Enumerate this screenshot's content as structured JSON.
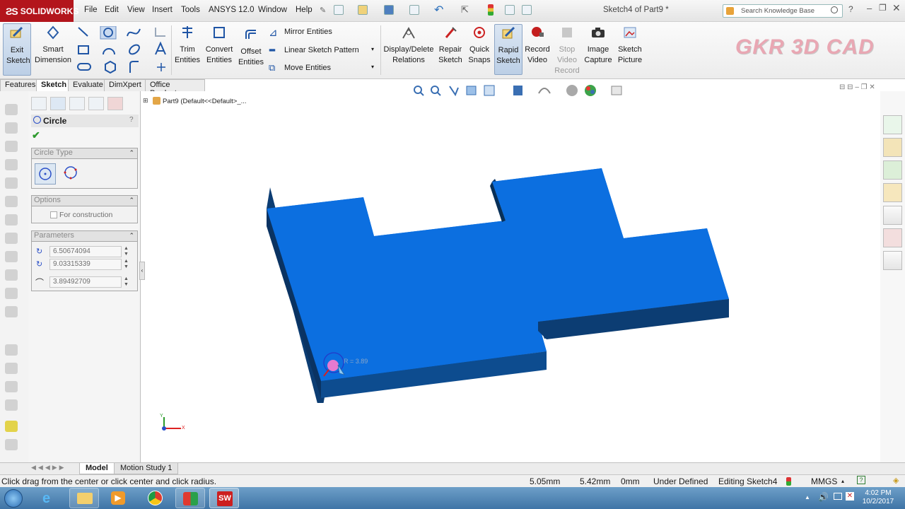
{
  "app": {
    "brand": "SOLIDWORKS",
    "doc_title": "Sketch4 of Part9 *"
  },
  "menu": [
    "File",
    "Edit",
    "View",
    "Insert",
    "Tools",
    "ANSYS 12.0",
    "Window",
    "Help"
  ],
  "search": {
    "placeholder": "Search Knowledge Base"
  },
  "toolbar": {
    "exit_sketch": "Exit Sketch",
    "smart_dimension": "Smart Dimension",
    "trim_entities": "Trim Entities",
    "convert_entities": "Convert Entities",
    "offset_entities": "Offset Entities",
    "mirror_entities": "Mirror Entities",
    "linear_sketch_pattern": "Linear Sketch Pattern",
    "move_entities": "Move Entities",
    "display_delete_relations": "Display/Delete Relations",
    "repair_sketch": "Repair Sketch",
    "quick_snaps": "Quick Snaps",
    "rapid_sketch": "Rapid Sketch",
    "record_video": "Record Video",
    "stop_video_record": "Stop Video Record",
    "image_capture": "Image Capture",
    "sketch_picture": "Sketch Picture"
  },
  "watermark": "GKR 3D CAD",
  "tabs": [
    "Features",
    "Sketch",
    "Evaluate",
    "DimXpert",
    "Office Products"
  ],
  "active_tab": "Sketch",
  "property_manager": {
    "title": "Circle",
    "help": "?",
    "circle_type_header": "Circle Type",
    "options_header": "Options",
    "for_construction": "For construction",
    "parameters_header": "Parameters",
    "center_x": "6.50674094",
    "center_y": "9.03315339",
    "radius": "3.89492709"
  },
  "tree": {
    "part_label": "Part9  (Default<<Default>_..."
  },
  "viewport": {
    "radius_label": "R = 3.89",
    "part_color": "#0c6fe0",
    "part_dark": "#0c3d73",
    "triad": {
      "y": "Y",
      "x": "X"
    }
  },
  "bottom_tabs": [
    "Model",
    "Motion Study 1"
  ],
  "status": {
    "hint": "Click drag from the center or click center and click radius.",
    "x": "5.05mm",
    "y": "5.42mm",
    "z": "0mm",
    "state": "Under Defined",
    "editing": "Editing Sketch4",
    "units": "MMGS"
  },
  "taskbar": {
    "time": "4:02 PM",
    "date": "10/2/2017"
  }
}
